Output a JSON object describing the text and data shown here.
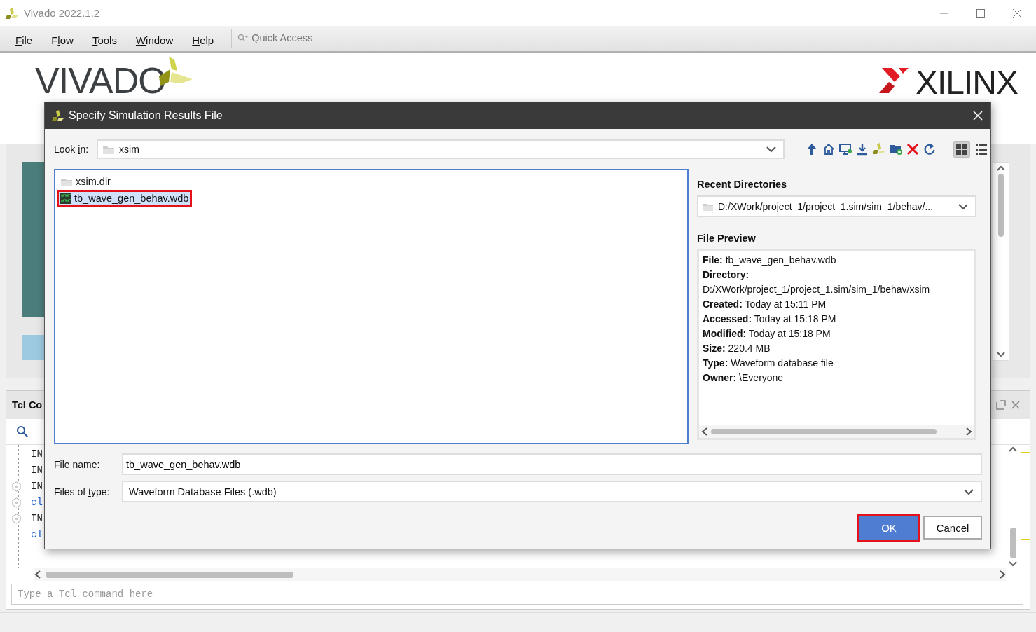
{
  "window": {
    "title": "Vivado 2022.1.2"
  },
  "menu": [
    {
      "key": "F",
      "post": "ile"
    },
    {
      "pre": "F",
      "key": "l",
      "post": "ow"
    },
    {
      "key": "T",
      "post": "ools"
    },
    {
      "key": "W",
      "post": "indow"
    },
    {
      "key": "H",
      "post": "elp"
    }
  ],
  "quick_access": {
    "placeholder": "Quick Access"
  },
  "banner": {
    "product_logo": "VIVADO",
    "company_logo": "XILINX"
  },
  "tcl_console": {
    "title": "Tcl Co",
    "lines": [
      {
        "text": "IN",
        "kind": "info",
        "collapsible": false
      },
      {
        "text": "IN",
        "kind": "info",
        "collapsible": false
      },
      {
        "text": "IN",
        "kind": "info",
        "collapsible": true
      },
      {
        "text": "cl",
        "kind": "command",
        "collapsible": true
      },
      {
        "text": "IN",
        "kind": "info",
        "collapsible": true
      },
      {
        "text": "cl",
        "kind": "command",
        "collapsible": false
      }
    ],
    "command_field": {
      "placeholder": "Type a Tcl command here"
    }
  },
  "dialog": {
    "title": "Specify Simulation Results File",
    "look_in": {
      "label": {
        "pre": "Look ",
        "key": "i",
        "post": "n:"
      },
      "value": "xsim"
    },
    "view_modes": [
      {
        "kind": "grid",
        "selected": true
      },
      {
        "kind": "details",
        "selected": false
      }
    ],
    "files": [
      {
        "name": "xsim.dir",
        "kind": "folder",
        "selected": false,
        "highlighted": false
      },
      {
        "name": "tb_wave_gen_behav.wdb",
        "kind": "waveform",
        "selected": true,
        "highlighted": true
      }
    ],
    "recent_directories": {
      "label": "Recent Directories",
      "value": "D:/XWork/project_1/project_1.sim/sim_1/behav/..."
    },
    "file_preview": {
      "label": "File Preview",
      "lines": [
        "**File:** tb_wave_gen_behav.wdb",
        "**Directory:**",
        "D:/XWork/project_1/project_1.sim/sim_1/behav/xsim",
        "**Created:** Today at 15:11 PM",
        "**Accessed:** Today at 15:18 PM",
        "**Modified:** Today at 15:18 PM",
        "**Size:** 220.4 MB",
        "**Type:** Waveform database file",
        "**Owner:** \\Everyone"
      ]
    },
    "file_name": {
      "label": {
        "pre": "File ",
        "key": "n",
        "post": "ame:"
      },
      "value": "tb_wave_gen_behav.wdb"
    },
    "files_of_type": {
      "label": {
        "pre": "Files of ",
        "key": "t",
        "post": "ype:"
      },
      "value": "Waveform Database Files (.wdb)"
    },
    "buttons": [
      {
        "label": "OK",
        "kind": "primary",
        "highlighted": true
      },
      {
        "label": "Cancel",
        "kind": "secondary",
        "highlighted": false
      }
    ]
  }
}
